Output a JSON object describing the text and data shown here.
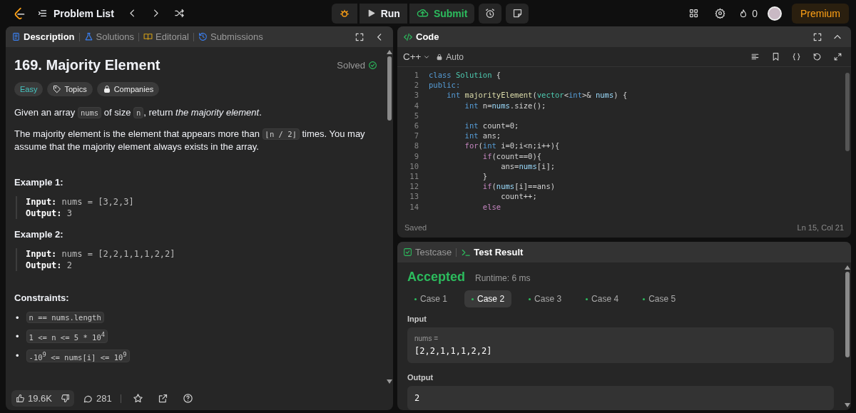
{
  "topbar": {
    "problem_list": "Problem List",
    "run": "Run",
    "submit": "Submit",
    "streak": "0",
    "premium": "Premium"
  },
  "description_panel": {
    "tabs": [
      {
        "label": "Description",
        "selected": true,
        "kind": "doc"
      },
      {
        "label": "Solutions",
        "selected": false,
        "kind": "flask"
      },
      {
        "label": "Editorial",
        "selected": false,
        "kind": "book"
      },
      {
        "label": "Submissions",
        "selected": false,
        "kind": "history"
      }
    ],
    "title": "169. Majority Element",
    "status": "Solved",
    "tags": [
      {
        "label": "Easy",
        "kind": "difficulty"
      },
      {
        "label": "Topics",
        "kind": "topics"
      },
      {
        "label": "Companies",
        "kind": "companies"
      }
    ],
    "paragraphs": [
      [
        {
          "kind": "text",
          "text": "Given an array "
        },
        {
          "kind": "code",
          "text": "nums"
        },
        {
          "kind": "text",
          "text": " of size "
        },
        {
          "kind": "code",
          "text": "n"
        },
        {
          "kind": "text",
          "text": ", return "
        },
        {
          "kind": "em",
          "text": "the majority element"
        },
        {
          "kind": "text",
          "text": "."
        }
      ],
      [
        {
          "kind": "text",
          "text": "The majority element is the element that appears more than "
        },
        {
          "kind": "code",
          "text": "⌊n / 2⌋"
        },
        {
          "kind": "text",
          "text": " times. You may assume that the majority element always exists in the array."
        }
      ]
    ],
    "examples": [
      {
        "heading": "Example 1:",
        "lines": [
          "**Input:** nums = [3,2,3]",
          "**Output:** 3"
        ]
      },
      {
        "heading": "Example 2:",
        "lines": [
          "**Input:** nums = [2,2,1,1,1,2,2]",
          "**Output:** 2"
        ]
      }
    ],
    "constraints_heading": "Constraints:",
    "constraints": [
      {
        "bullet": "•",
        "text": "n == nums.length"
      },
      {
        "bullet": "•",
        "text": "1 <= n <= 5 * 10$^{4}$"
      },
      {
        "bullet": "•",
        "text": "-10$^{9}$ <= nums[i] <= 10$^{9}$"
      }
    ],
    "likes": "19.6K",
    "comments": "281"
  },
  "code_panel": {
    "title": "Code",
    "language": "C++",
    "mode": "Auto",
    "lines": [
      {
        "number": "1",
        "tokens": [
          {
            "kind": "keyword",
            "text": "class "
          },
          {
            "kind": "type",
            "text": "Solution"
          },
          {
            "kind": "plain",
            "text": " {"
          }
        ]
      },
      {
        "number": "2",
        "tokens": [
          {
            "kind": "keyword",
            "text": "public:"
          }
        ],
        "children": [
          {
            "number": "3",
            "tokens": [
              {
                "kind": "keyword",
                "text": "int "
              },
              {
                "kind": "function",
                "text": "majorityElement"
              },
              {
                "kind": "plain",
                "text": "("
              },
              {
                "kind": "type",
                "text": "vector"
              },
              {
                "kind": "plain",
                "text": "<"
              },
              {
                "kind": "keyword",
                "text": "int"
              },
              {
                "kind": "plain",
                "text": ">& "
              },
              {
                "kind": "variable",
                "text": "nums"
              },
              {
                "kind": "plain",
                "text": ") {"
              }
            ],
            "children": [
              {
                "number": "4",
                "tokens": [
                  {
                    "kind": "keyword",
                    "text": "int "
                  },
                  {
                    "kind": "plain",
                    "text": "n="
                  },
                  {
                    "kind": "variable",
                    "text": "nums"
                  },
                  {
                    "kind": "plain",
                    "text": ".size();"
                  }
                ]
              },
              {
                "number": "5"
              },
              {
                "number": "6",
                "tokens": [
                  {
                    "kind": "keyword",
                    "text": "int "
                  },
                  {
                    "kind": "plain",
                    "text": "count=0;"
                  }
                ]
              },
              {
                "number": "7",
                "tokens": [
                  {
                    "kind": "keyword",
                    "text": "int "
                  },
                  {
                    "kind": "plain",
                    "text": "ans;"
                  }
                ]
              },
              {
                "number": "8",
                "tokens": [
                  {
                    "kind": "control",
                    "text": "for"
                  },
                  {
                    "kind": "plain",
                    "text": "("
                  },
                  {
                    "kind": "keyword",
                    "text": "int "
                  },
                  {
                    "kind": "plain",
                    "text": "i=0;i<n;i++){"
                  }
                ],
                "children": [
                  {
                    "number": "9",
                    "tokens": [
                      {
                        "kind": "control",
                        "text": "if"
                      },
                      {
                        "kind": "plain",
                        "text": "(count==0){"
                      }
                    ],
                    "children": [
                      {
                        "number": "10",
                        "tokens": [
                          {
                            "kind": "plain",
                            "text": "ans="
                          },
                          {
                            "kind": "variable",
                            "text": "nums"
                          },
                          {
                            "kind": "plain",
                            "text": "[i];"
                          }
                        ]
                      }
                    ]
                  },
                  {
                    "number": "11",
                    "tokens": [
                      {
                        "kind": "plain",
                        "text": "}"
                      }
                    ]
                  },
                  {
                    "number": "12",
                    "tokens": [
                      {
                        "kind": "control",
                        "text": "if"
                      },
                      {
                        "kind": "plain",
                        "text": "("
                      },
                      {
                        "kind": "variable",
                        "text": "nums"
                      },
                      {
                        "kind": "plain",
                        "text": "[i]==ans)"
                      }
                    ],
                    "children": [
                      {
                        "number": "13",
                        "tokens": [
                          {
                            "kind": "plain",
                            "text": "count++;"
                          }
                        ]
                      }
                    ]
                  },
                  {
                    "number": "14",
                    "tokens": [
                      {
                        "kind": "control",
                        "text": "else"
                      }
                    ]
                  }
                ]
              }
            ]
          }
        ]
      }
    ],
    "saved": "Saved",
    "cursor": "Ln 15, Col 21"
  },
  "test_panel": {
    "tabs": [
      {
        "label": "Testcase",
        "selected": false,
        "kind": "check"
      },
      {
        "label": "Test Result",
        "selected": true,
        "kind": "terminal"
      }
    ],
    "verdict": "Accepted",
    "runtime": "Runtime: 6 ms",
    "cases": [
      {
        "label": "Case 1",
        "selected": false
      },
      {
        "label": "Case 2",
        "selected": true
      },
      {
        "label": "Case 3",
        "selected": false
      },
      {
        "label": "Case 4",
        "selected": false
      },
      {
        "label": "Case 5",
        "selected": false
      }
    ],
    "input_heading": "Input",
    "input_name": "nums =",
    "input_value": "[2,2,1,1,1,2,2]",
    "output_heading": "Output",
    "output_value": "2"
  }
}
